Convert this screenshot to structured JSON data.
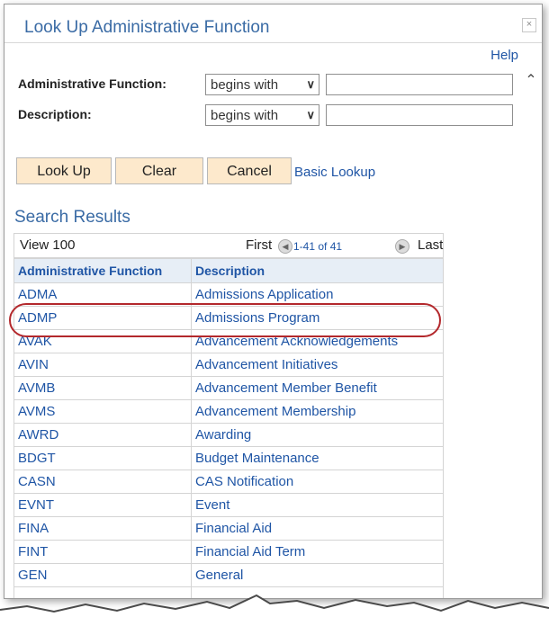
{
  "dialog": {
    "title": "Look Up Administrative Function",
    "close_symbol": "×",
    "help_label": "Help"
  },
  "criteria": {
    "fields": [
      {
        "label": "Administrative Function:",
        "operator": "begins with",
        "value": ""
      },
      {
        "label": "Description:",
        "operator": "begins with",
        "value": ""
      }
    ]
  },
  "buttons": {
    "lookup": "Look Up",
    "clear": "Clear",
    "cancel": "Cancel",
    "basic_lookup": "Basic Lookup"
  },
  "results": {
    "title": "Search Results",
    "view_all": "View 100",
    "first": "First",
    "range": "1-41 of 41",
    "last": "Last",
    "columns": [
      "Administrative Function",
      "Description"
    ],
    "rows": [
      [
        "ADMA",
        "Admissions Application"
      ],
      [
        "ADMP",
        "Admissions Program"
      ],
      [
        "AVAK",
        "Advancement Acknowledgements"
      ],
      [
        "AVIN",
        "Advancement Initiatives"
      ],
      [
        "AVMB",
        "Advancement Member Benefit"
      ],
      [
        "AVMS",
        "Advancement Membership"
      ],
      [
        "AWRD",
        "Awarding"
      ],
      [
        "BDGT",
        "Budget Maintenance"
      ],
      [
        "CASN",
        "CAS Notification"
      ],
      [
        "EVNT",
        "Event"
      ],
      [
        "FINA",
        "Financial Aid"
      ],
      [
        "FINT",
        "Financial Aid Term"
      ],
      [
        "GEN",
        "General"
      ],
      [
        "",
        ""
      ]
    ]
  },
  "colors": {
    "accent": "#3a6ba5",
    "link": "#1f55a5",
    "button_bg": "#fde9cc",
    "highlight": "#b3282c"
  }
}
